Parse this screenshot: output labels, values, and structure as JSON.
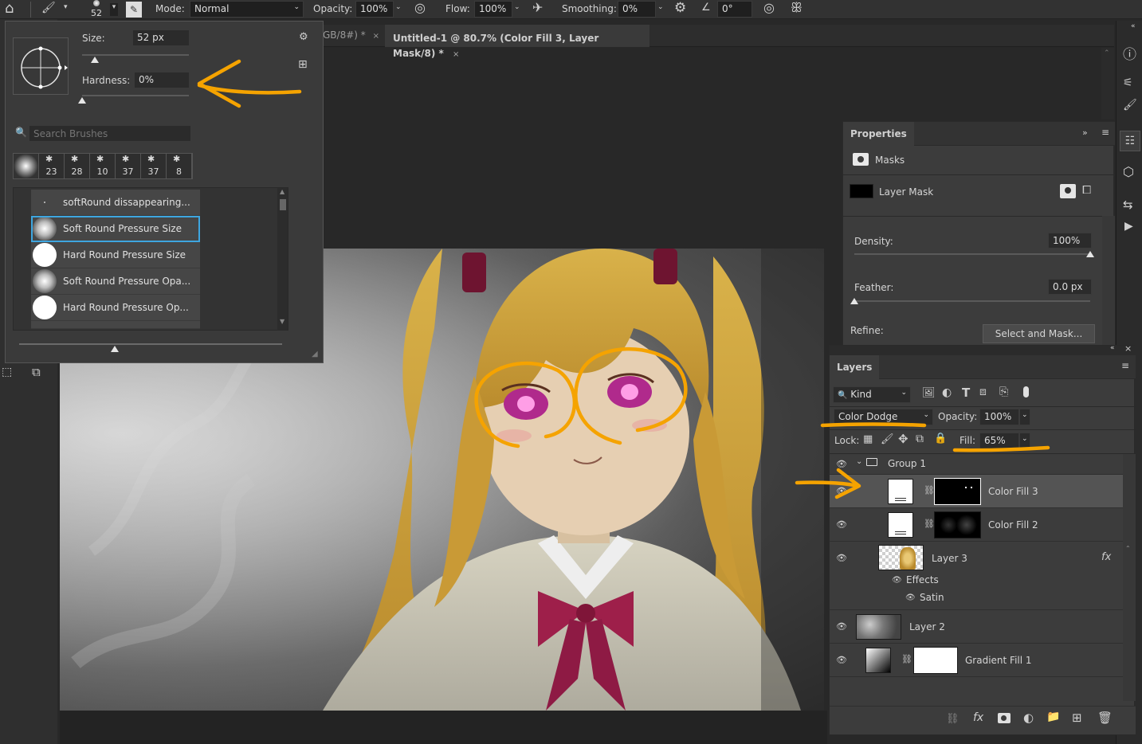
{
  "options_bar": {
    "brush_size_display": "52",
    "mode_label": "Mode:",
    "mode_value": "Normal",
    "opacity_label": "Opacity:",
    "opacity_value": "100%",
    "flow_label": "Flow:",
    "flow_value": "100%",
    "smoothing_label": "Smoothing:",
    "smoothing_value": "0%",
    "angle_value": "0°"
  },
  "brush_popup": {
    "size_label": "Size:",
    "size_value": "52 px",
    "size_slider_fraction": 0.12,
    "hardness_label": "Hardness:",
    "hardness_value": "0%",
    "hardness_slider_fraction": 0.0,
    "search_placeholder": "Search Brushes",
    "recent_sizes": [
      "23",
      "28",
      "10",
      "37",
      "37",
      "8"
    ],
    "brushes": [
      {
        "label": "softRound dissappearing...",
        "style": "dot"
      },
      {
        "label": "Soft Round Pressure Size",
        "style": "soft",
        "selected": true
      },
      {
        "label": "Hard Round Pressure Size",
        "style": "hard"
      },
      {
        "label": "Soft Round Pressure Opa...",
        "style": "soft"
      },
      {
        "label": "Hard Round Pressure Op...",
        "style": "hard"
      }
    ]
  },
  "document_tabs": [
    {
      "label": "GB/8#) *",
      "active": false
    },
    {
      "label": "Untitled-1 @ 80.7% (Color Fill 3, Layer Mask/8) *",
      "active": true
    }
  ],
  "properties": {
    "title": "Properties",
    "masks_label": "Masks",
    "layer_mask_label": "Layer Mask",
    "density_label": "Density:",
    "density_value": "100%",
    "density_fraction": 1.0,
    "feather_label": "Feather:",
    "feather_value": "0.0 px",
    "feather_fraction": 0.0,
    "refine_label": "Refine:",
    "select_mask_button": "Select and Mask..."
  },
  "layers": {
    "title": "Layers",
    "kind_label": "Kind",
    "blend_mode": "Color Dodge",
    "opacity_label": "Opacity:",
    "opacity_value": "100%",
    "lock_label": "Lock:",
    "fill_label": "Fill:",
    "fill_value": "65%",
    "group_name": "Group 1",
    "items": [
      {
        "name": "Color Fill 3",
        "selected": true
      },
      {
        "name": "Color Fill 2"
      },
      {
        "name": "Layer 3",
        "fx": "fx"
      },
      {
        "name": "Layer 2"
      },
      {
        "name": "Gradient Fill 1"
      }
    ],
    "effects_label": "Effects",
    "satin_label": "Satin"
  },
  "colors": {
    "annotation": "#f5a300",
    "selection_border": "#3ea6e0",
    "panel_bg": "#3c3c3c",
    "app_bg": "#282828"
  }
}
